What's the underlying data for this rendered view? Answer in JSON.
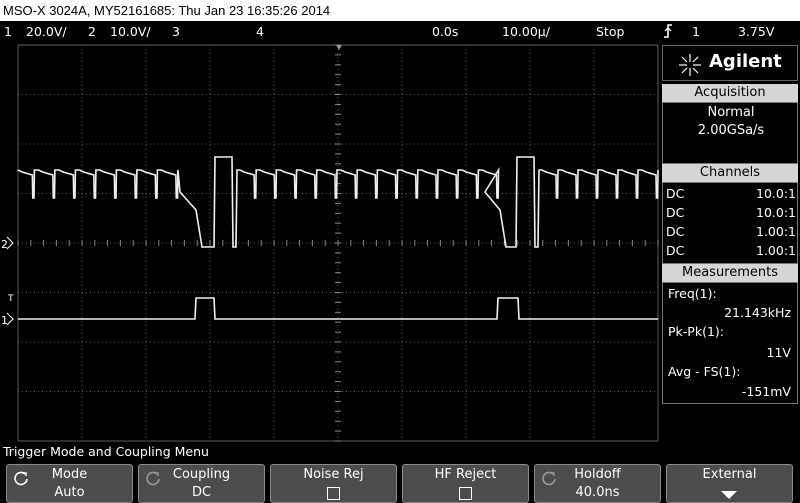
{
  "title": "MSO-X 3024A, MY52161685: Thu Jan 23 16:35:26 2014",
  "status": {
    "ch1_num": "1",
    "ch1_scale": "20.0V/",
    "ch2_num": "2",
    "ch2_scale": "10.0V/",
    "ch3_num": "3",
    "ch4_num": "4",
    "delay": "0.0s",
    "timebase": "10.00µ/",
    "run_state": "Stop",
    "trigger_source": "1",
    "trigger_level": "3.75V"
  },
  "brand": "Agilent",
  "acquisition": {
    "heading": "Acquisition",
    "mode": "Normal",
    "rate": "2.00GSa/s"
  },
  "channels": {
    "heading": "Channels",
    "rows": [
      {
        "coupling": "DC",
        "probe": "10.0:1"
      },
      {
        "coupling": "DC",
        "probe": "10.0:1"
      },
      {
        "coupling": "DC",
        "probe": "1.00:1"
      },
      {
        "coupling": "DC",
        "probe": "1.00:1"
      }
    ]
  },
  "measurements": {
    "heading": "Measurements",
    "items": [
      {
        "name": "Freq(1):",
        "value": "21.143kHz"
      },
      {
        "name": "Pk-Pk(1):",
        "value": "11V"
      },
      {
        "name": "Avg - FS(1):",
        "value": "-151mV"
      }
    ]
  },
  "markers": {
    "ch2_ground": "2",
    "ch1_ground": "1",
    "trigger_marker": "T"
  },
  "menu_title": "Trigger Mode and Coupling Menu",
  "softkeys": [
    {
      "label": "Mode",
      "value": "Auto"
    },
    {
      "label": "Coupling",
      "value": "DC"
    },
    {
      "label": "Noise Rej",
      "value": ""
    },
    {
      "label": "HF Reject",
      "value": ""
    },
    {
      "label": "Holdoff",
      "value": "40.0ns"
    },
    {
      "label": "External",
      "value": ""
    }
  ],
  "colors": {
    "background": "#000000",
    "trace": "#f0f0f0",
    "grid": "#5a5a5a",
    "softkey": "#4c4c4c",
    "header": "#d6d6d6"
  },
  "icons": {
    "trigger": "trigger-edge-icon",
    "knob": "rotary-knob-icon",
    "logo": "agilent-spark-icon",
    "arrow": "arrow-down-icon"
  }
}
